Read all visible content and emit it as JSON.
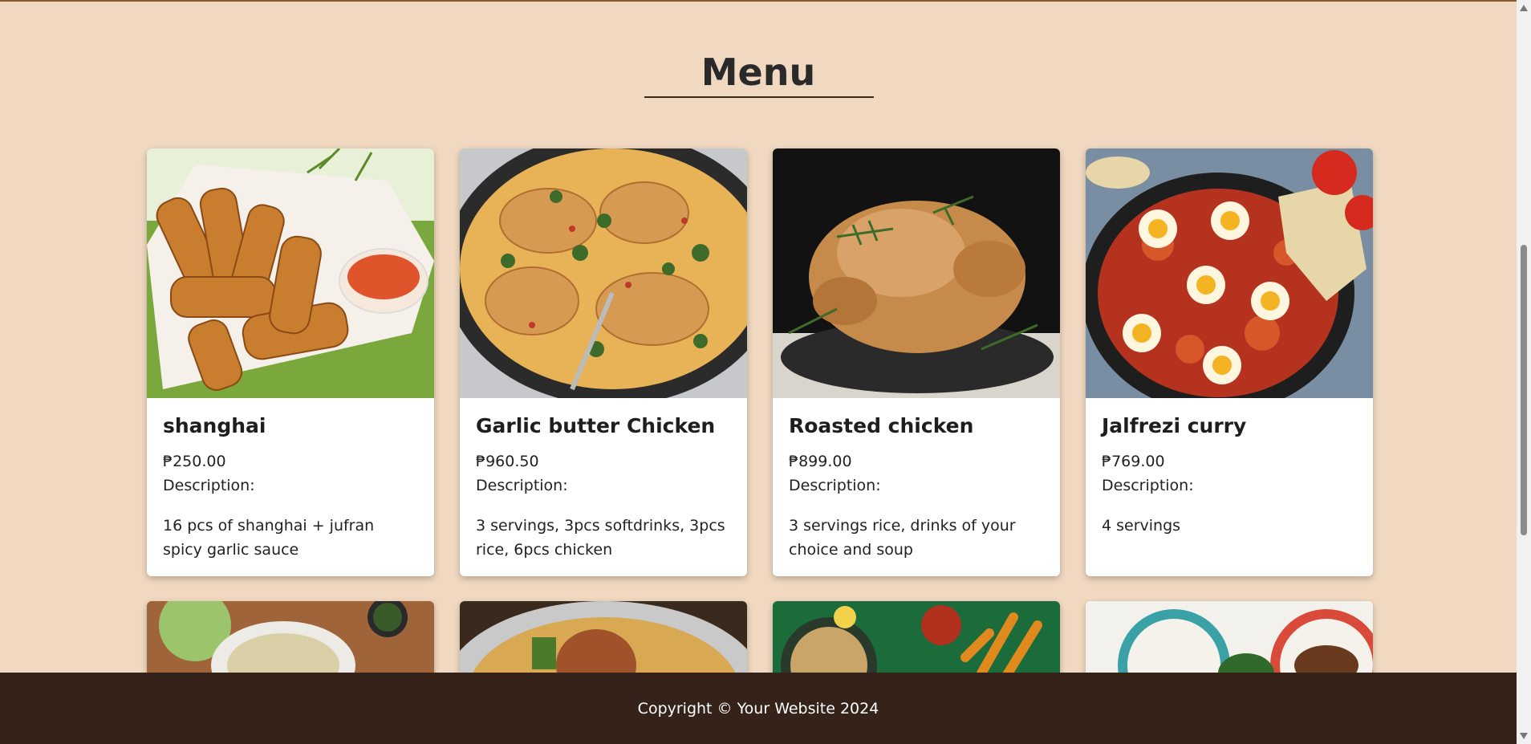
{
  "menu": {
    "title": "Menu"
  },
  "items": [
    {
      "name": "shanghai",
      "price": "₱250.00",
      "desc_label": "Description:",
      "description": "16 pcs of shanghai + jufran spicy garlic sauce"
    },
    {
      "name": "Garlic butter Chicken",
      "price": "₱960.50",
      "desc_label": "Description:",
      "description": "3 servings, 3pcs softdrinks, 3pcs rice, 6pcs chicken"
    },
    {
      "name": "Roasted chicken",
      "price": "₱899.00",
      "desc_label": "Description:",
      "description": "3 servings rice, drinks of your choice and soup"
    },
    {
      "name": "Jalfrezi curry",
      "price": "₱769.00",
      "desc_label": "Description:",
      "description": "4 servings"
    }
  ],
  "footer": {
    "text": "Copyright © Your Website 2024"
  },
  "colors": {
    "background": "#f0d9c0",
    "footer": "#352218",
    "card": "#ffffff"
  }
}
